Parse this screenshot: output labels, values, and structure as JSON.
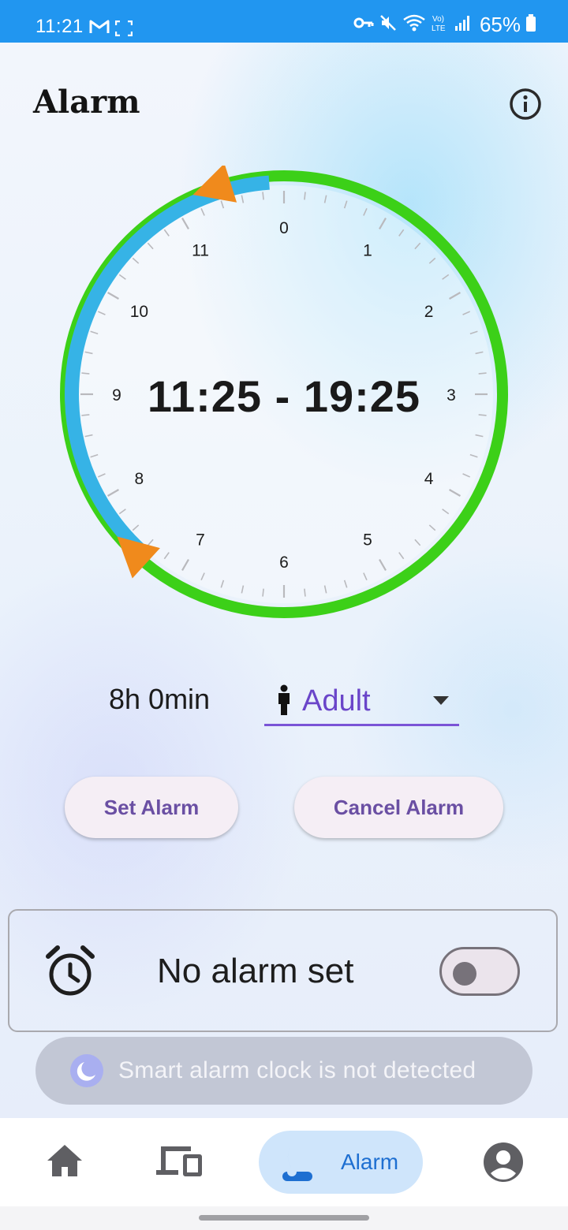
{
  "status_bar": {
    "time": "11:21",
    "battery_percent": "65%"
  },
  "header": {
    "title": "Alarm"
  },
  "clock": {
    "hour_labels": [
      "0",
      "1",
      "2",
      "3",
      "4",
      "5",
      "6",
      "7",
      "8",
      "9",
      "10",
      "11"
    ],
    "time_range": "11:25 - 19:25",
    "start_hour": 11.4167,
    "end_hour": 19.4167,
    "colors": {
      "outer_ring": "#3cd018",
      "inner_arc": "#36b3e6",
      "handles": "#f08a1c"
    }
  },
  "controls": {
    "duration": "8h 0min",
    "profile": "Adult"
  },
  "buttons": {
    "set_label": "Set Alarm",
    "cancel_label": "Cancel Alarm"
  },
  "alarm_card": {
    "status_text": "No alarm set",
    "toggle_on": false
  },
  "toast": {
    "message": "Smart alarm clock is not detected"
  },
  "bottom_nav": {
    "items": [
      {
        "icon": "home-icon"
      },
      {
        "icon": "devices-icon"
      },
      {
        "icon": "moon-icon",
        "label": "Alarm",
        "active": true
      },
      {
        "icon": "account-icon"
      }
    ]
  }
}
